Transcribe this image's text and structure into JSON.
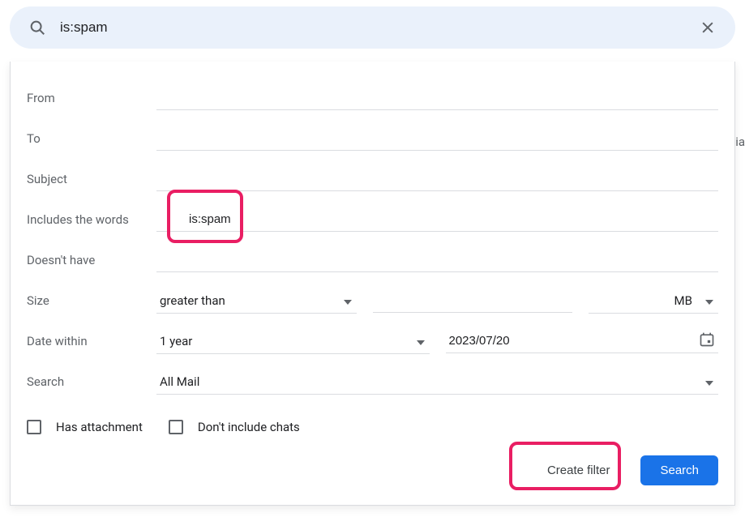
{
  "searchBar": {
    "value": "is:spam"
  },
  "form": {
    "from": {
      "label": "From",
      "value": ""
    },
    "to": {
      "label": "To",
      "value": ""
    },
    "subject": {
      "label": "Subject",
      "value": ""
    },
    "includes": {
      "label": "Includes the words",
      "value": "is:spam"
    },
    "doesntHave": {
      "label": "Doesn't have",
      "value": ""
    },
    "size": {
      "label": "Size",
      "comparison": "greater than",
      "amount": "",
      "unit": "MB"
    },
    "dateWithin": {
      "label": "Date within",
      "range": "1 year",
      "date": "2023/07/20"
    },
    "searchIn": {
      "label": "Search",
      "value": "All Mail"
    }
  },
  "checkboxes": {
    "hasAttachment": {
      "label": "Has attachment",
      "checked": false
    },
    "excludeChats": {
      "label": "Don't include chats",
      "checked": false
    }
  },
  "actions": {
    "createFilter": "Create filter",
    "search": "Search"
  },
  "peek": {
    "sideLetters": "ia"
  }
}
